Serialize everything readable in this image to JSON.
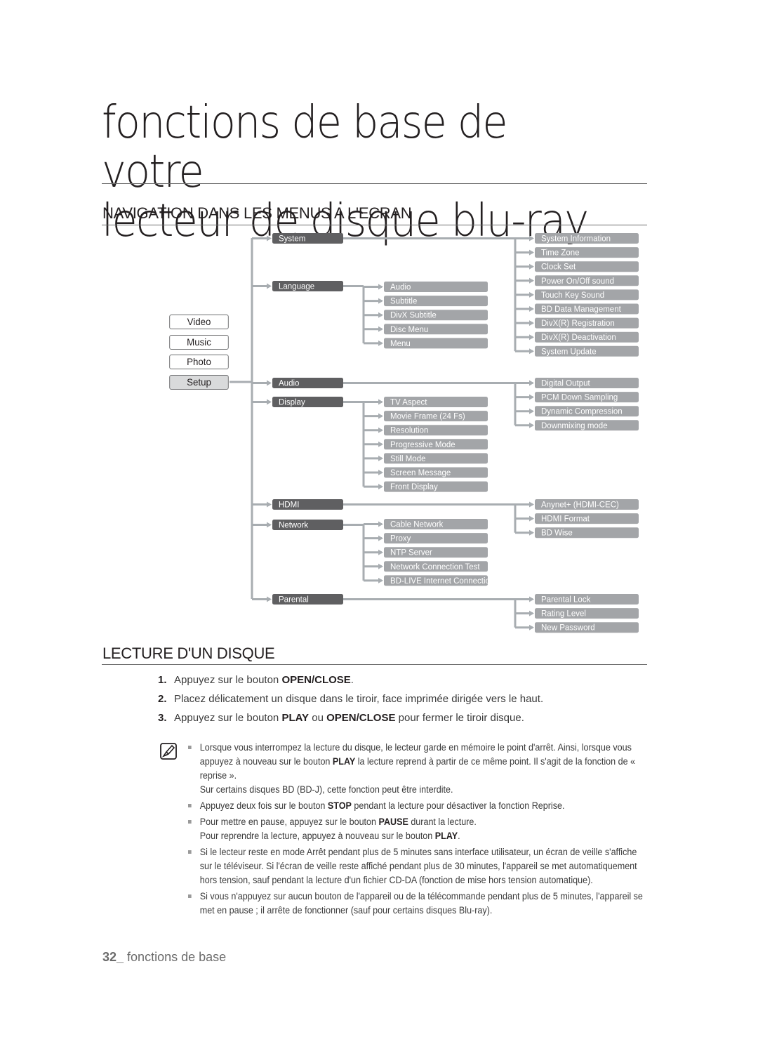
{
  "chapter_title_line1": "fonctions de base de votre",
  "chapter_title_line2": "lecteur de disque blu-ray",
  "section_nav": "NAVIGATION DANS LES MENUS A L'ECRAN",
  "section_play": "LECTURE D'UN DISQUE",
  "colors": {
    "dark_box": "#5f5f61",
    "light_box": "#a3a5a8",
    "connector": "#a8adb1"
  },
  "menu_buttons": [
    {
      "label": "Video",
      "active": false
    },
    {
      "label": "Music",
      "active": false
    },
    {
      "label": "Photo",
      "active": false
    },
    {
      "label": "Setup",
      "active": true
    }
  ],
  "setup_tree": [
    {
      "label": "System",
      "children": [],
      "right": [
        "System Information",
        "Time Zone",
        "Clock Set",
        "Power On/Off sound",
        "Touch Key Sound",
        "BD Data Management",
        "DivX(R) Registration",
        "DivX(R) Deactivation",
        "System Update"
      ]
    },
    {
      "label": "Language",
      "children": [
        "Audio",
        "Subtitle",
        "DivX Subtitle",
        "Disc Menu",
        "Menu"
      ],
      "right": []
    },
    {
      "label": "Audio",
      "children": [],
      "right": [
        "Digital Output",
        "PCM Down Sampling",
        "Dynamic Compression",
        "Downmixing mode"
      ]
    },
    {
      "label": "Display",
      "children": [
        "TV Aspect",
        "Movie Frame (24 Fs)",
        "Resolution",
        "Progressive Mode",
        "Still Mode",
        "Screen Message",
        "Front Display"
      ],
      "right": []
    },
    {
      "label": "HDMI",
      "children": [],
      "right": [
        "Anynet+ (HDMI-CEC)",
        "HDMI Format",
        "BD Wise"
      ]
    },
    {
      "label": "Network",
      "children": [
        "Cable Network",
        "Proxy",
        "NTP Server",
        "Network Connection Test",
        "BD-LIVE Internet Connection"
      ],
      "right": []
    },
    {
      "label": "Parental",
      "children": [],
      "right": [
        "Parental Lock",
        "Rating Level",
        "New Password"
      ]
    }
  ],
  "steps": [
    {
      "num": "1.",
      "pre": "Appuyez sur le bouton ",
      "b1": "OPEN/CLOSE",
      "mid": ".",
      "b2": "",
      "post": ""
    },
    {
      "num": "2.",
      "pre": "Placez délicatement un disque dans le tiroir, face imprimée dirigée vers le haut.",
      "b1": "",
      "mid": "",
      "b2": "",
      "post": ""
    },
    {
      "num": "3.",
      "pre": "Appuyez sur le bouton ",
      "b1": "PLAY",
      "mid": " ou ",
      "b2": "OPEN/CLOSE",
      "post": " pour fermer le tiroir disque."
    }
  ],
  "notes": [
    {
      "pre": "Lorsque vous interrompez la lecture du disque, le lecteur garde en mémoire le point d'arrêt. Ainsi, lorsque vous appuyez à nouveau sur le bouton ",
      "b": "PLAY",
      "post": " la lecture reprend à partir de ce même point. Il s'agit de la fonction de « reprise ».",
      "extra": "Sur certains disques BD (BD-J), cette fonction peut être interdite.",
      "extra_b": ""
    },
    {
      "pre": "Appuyez deux fois sur le bouton ",
      "b": "STOP",
      "post": " pendant la lecture pour désactiver la fonction Reprise.",
      "extra": "",
      "extra_b": ""
    },
    {
      "pre": "Pour mettre en pause, appuyez sur le bouton ",
      "b": "PAUSE",
      "post": " durant la lecture.",
      "extra": "Pour reprendre la lecture, appuyez à nouveau sur le bouton ",
      "extra_b": "PLAY"
    },
    {
      "pre": "Si le lecteur reste en mode Arrêt pendant plus de 5 minutes sans interface utilisateur, un écran de veille s'affiche sur le téléviseur. Si l'écran de veille reste affiché pendant plus de 30 minutes, l'appareil se met automatiquement hors tension, sauf pendant la lecture d'un fichier CD-DA (fonction de mise hors tension automatique).",
      "b": "",
      "post": "",
      "extra": "",
      "extra_b": ""
    },
    {
      "pre": "Si vous n'appuyez sur aucun bouton de l'appareil ou de la télécommande pendant plus de 5 minutes, l'appareil se met en pause ; il arrête de fonctionner (sauf pour certains disques Blu-ray).",
      "b": "",
      "post": "",
      "extra": "",
      "extra_b": ""
    }
  ],
  "footer": {
    "page": "32_",
    "label": " fonctions de base"
  }
}
